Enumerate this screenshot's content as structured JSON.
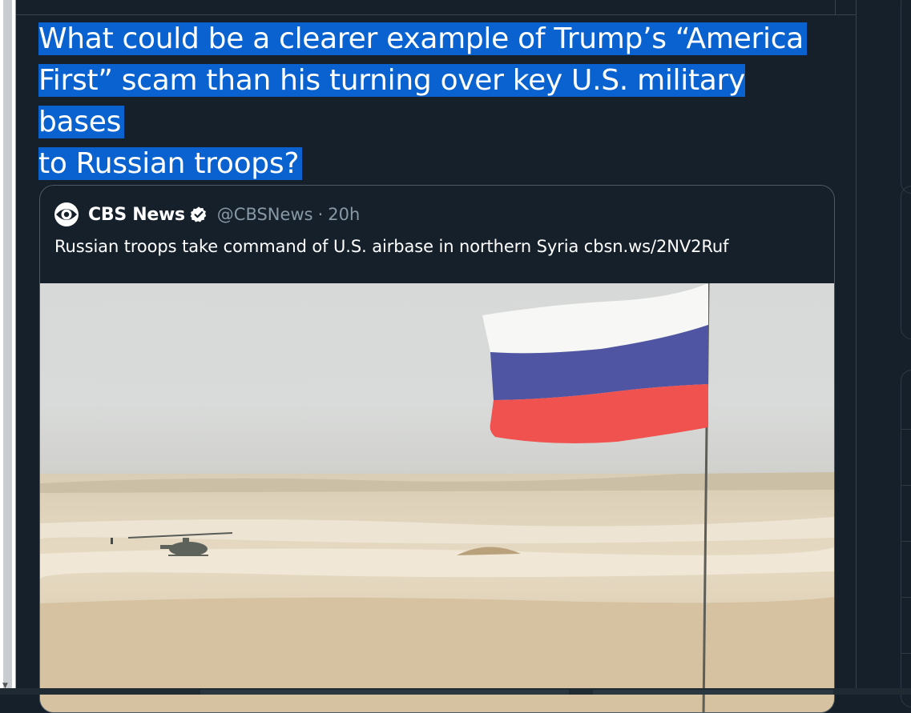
{
  "tweet": {
    "text_lines": [
      "What could be a clearer example of Trump’s “America",
      "First” scam than his turning over key U.S. military bases",
      "to Russian troops?"
    ]
  },
  "quoted_tweet": {
    "author_name": "CBS News",
    "handle": "@CBSNews",
    "separator": "·",
    "time": "20h",
    "text": "Russian troops take command of U.S. airbase in northern Syria cbsn.ws/2NV2Ruf",
    "avatar_icon": "cbs-eye-logo-icon",
    "verified_icon": "verified-badge-icon"
  },
  "colors": {
    "background": "#15202b",
    "selection_highlight": "#0a62d0",
    "secondary_text": "#8899a6",
    "border": "#38444d"
  }
}
